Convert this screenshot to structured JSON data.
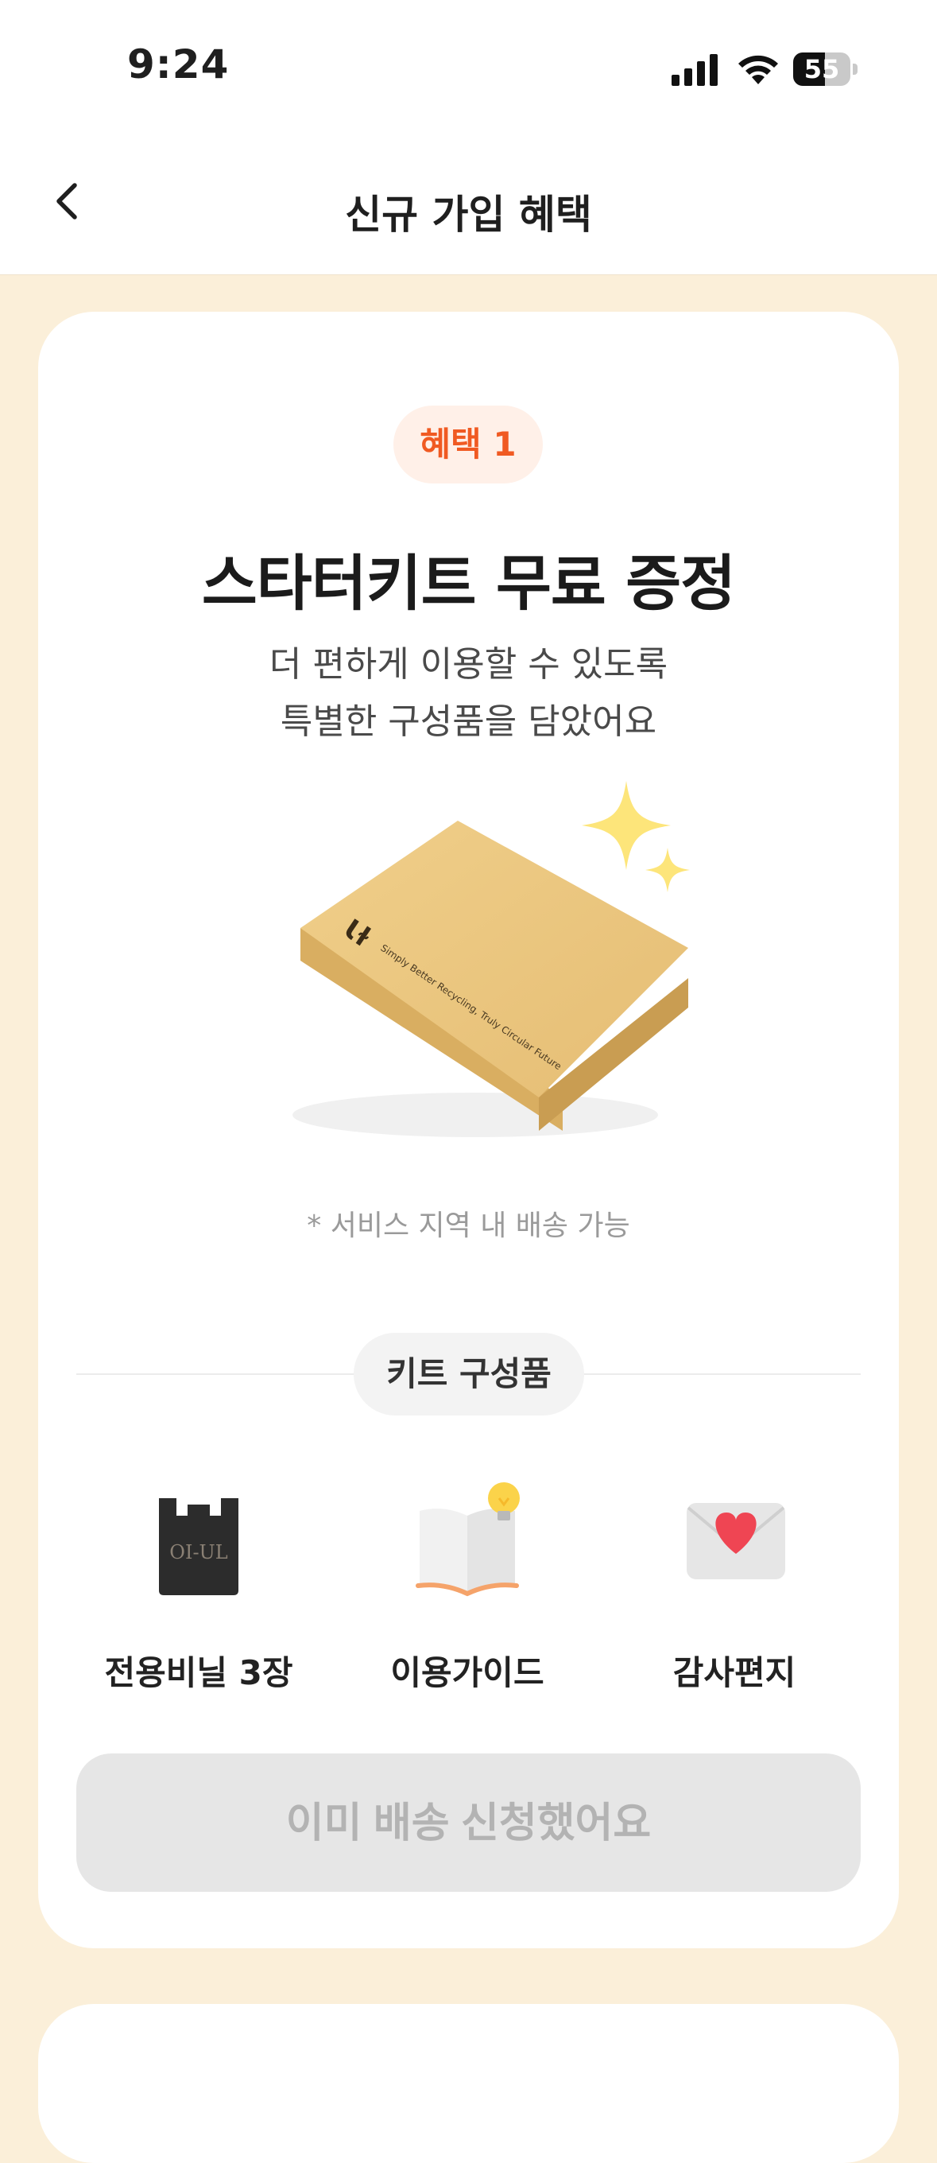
{
  "status_bar": {
    "time": "9:24",
    "battery_level": "55",
    "battery_fraction": 0.55,
    "icons": [
      "cellular-signal-icon",
      "wifi-icon",
      "battery-icon"
    ]
  },
  "nav": {
    "title": "신규 가입 혜택",
    "back_icon": "chevron-left-icon"
  },
  "benefit": {
    "badge": "혜택 1",
    "title": "스타터키트 무료 증정",
    "subtitle_lines": [
      "더 편하게 이용할 수 있도록",
      "특별한 구성품을 담았어요"
    ],
    "box_brand": "Simply Better Recycling, Truly Circular Future",
    "box_logo": "Ɩɫ",
    "note": "* 서비스 지역 내 배송 가능",
    "kit_label": "키트 구성품",
    "items": [
      {
        "label": "전용비닐 3장",
        "icon": "plastic-bag-icon",
        "bag_text": "OI-UL"
      },
      {
        "label": "이용가이드",
        "icon": "guide-book-icon"
      },
      {
        "label": "감사편지",
        "icon": "heart-letter-icon"
      }
    ],
    "cta_label": "이미 배송 신청했어요"
  },
  "colors": {
    "accent": "#f05a22",
    "badge_bg": "#fff0e8",
    "page_bg": "#fbefd9",
    "disabled_bg": "#e6e6e6",
    "disabled_text": "#b3b3b3"
  }
}
